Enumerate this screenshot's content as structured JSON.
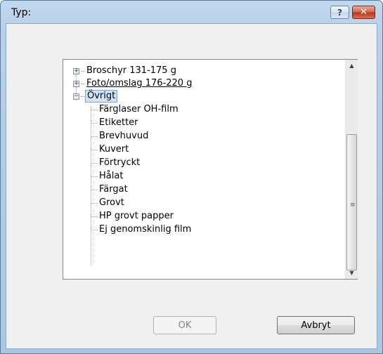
{
  "window": {
    "title": "Typ:",
    "help_symbol": "?",
    "close_symbol": "✕"
  },
  "tree": {
    "nodes": [
      {
        "label": "Broschyr 131-175 g",
        "expander": "+"
      },
      {
        "label": "Foto/omslag 176-220 g",
        "expander": "+"
      },
      {
        "label": "Övrigt",
        "expander": "−",
        "selected": true
      }
    ],
    "children": [
      "Färglaser OH-film",
      "Etiketter",
      "Brevhuvud",
      "Kuvert",
      "Förtryckt",
      "Hålat",
      "Färgat",
      "Grovt",
      "HP grovt papper",
      "Ej genomskinlig film"
    ]
  },
  "scrollbar": {
    "up_arrow": "▲",
    "down_arrow": "▼",
    "grip": "≡",
    "position_fraction": 1.0
  },
  "buttons": {
    "ok_label": "OK",
    "ok_enabled": false,
    "cancel_label": "Avbryt"
  },
  "colors": {
    "selection_fill": "#cfe3fa",
    "selection_border": "#7da2ce",
    "window_frame": "#b9d1ea",
    "close_button": "#c7432d"
  }
}
